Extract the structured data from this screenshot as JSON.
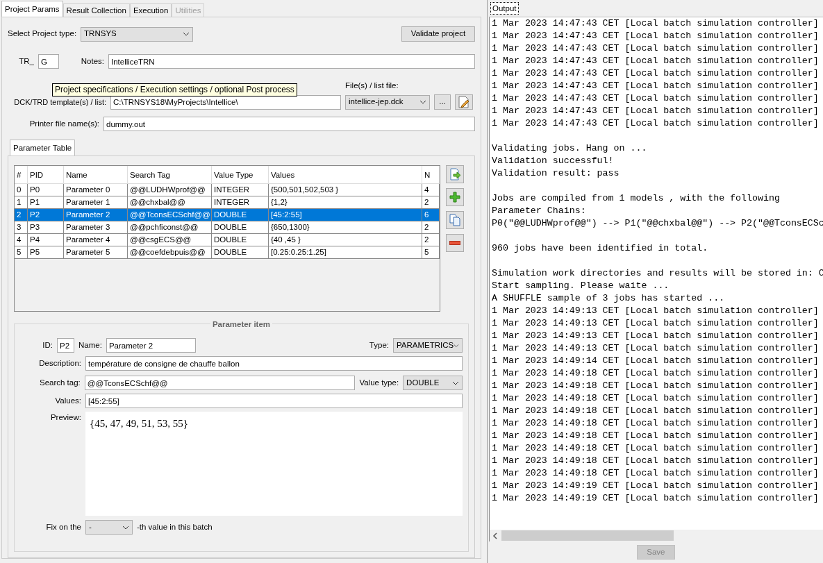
{
  "left_tabs": [
    {
      "label": "Project Params",
      "selected": true,
      "disabled": false
    },
    {
      "label": "Result Collection",
      "selected": false,
      "disabled": false
    },
    {
      "label": "Execution",
      "selected": false,
      "disabled": false
    },
    {
      "label": "Utilities",
      "selected": false,
      "disabled": true
    }
  ],
  "project_type": {
    "label": "Select Project type:",
    "value": "TRNSYS"
  },
  "validate_button": "Validate project",
  "prefix": {
    "label": "TR_",
    "value": "G"
  },
  "notes": {
    "label": "Notes:",
    "value": "IntelliceTRN"
  },
  "file_list": {
    "label": "File(s) / list file:",
    "value": "intellice-jep.dck",
    "browse_button": "..."
  },
  "template": {
    "label": "DCK/TRD template(s) / list:",
    "value": "C:\\TRNSYS18\\MyProjects\\Intellice\\"
  },
  "printer": {
    "label": "Printer file name(s):",
    "value": "dummy.out"
  },
  "tooltip": "Project specifications / Execution settings / optional Post process",
  "param_tab": {
    "label": "Parameter Table",
    "selected": true
  },
  "table": {
    "columns": [
      "#",
      "PID",
      "Name",
      "Search Tag",
      "Value Type",
      "Values",
      "N"
    ],
    "rows": [
      {
        "cells": [
          "0",
          "P0",
          "Parameter 0",
          "@@LUDHWprof@@",
          "INTEGER",
          "{500,501,502,503 }",
          "4"
        ],
        "selected": false
      },
      {
        "cells": [
          "1",
          "P1",
          "Parameter 1",
          "@@chxbal@@",
          "INTEGER",
          "{1,2}",
          "2"
        ],
        "selected": false
      },
      {
        "cells": [
          "2",
          "P2",
          "Parameter 2",
          "@@TconsECSchf@@",
          "DOUBLE",
          "[45:2:55]",
          "6"
        ],
        "selected": true
      },
      {
        "cells": [
          "3",
          "P3",
          "Parameter 3",
          "@@pchficonst@@",
          "DOUBLE",
          "{650,1300}",
          "2"
        ],
        "selected": false
      },
      {
        "cells": [
          "4",
          "P4",
          "Parameter 4",
          "@@csgECS@@",
          "DOUBLE",
          "{40 ,45 }",
          "2"
        ],
        "selected": false
      },
      {
        "cells": [
          "5",
          "P5",
          "Parameter 5",
          "@@coefdebpuis@@",
          "DOUBLE",
          "[0.25:0.25:1.25]",
          "5"
        ],
        "selected": false
      }
    ]
  },
  "param_item": {
    "title": "Parameter item",
    "id_label": "ID:",
    "id": "P2",
    "name_label": "Name:",
    "name": "Parameter 2",
    "type_label": "Type:",
    "type": "PARAMETRICS",
    "description_label": "Description:",
    "description": "température de consigne de chauffe ballon",
    "search_tag_label": "Search tag:",
    "search_tag": "@@TconsECSchf@@",
    "value_type_label": "Value type:",
    "value_type": "DOUBLE",
    "values_label": "Values:",
    "values": "[45:2:55]",
    "preview_label": "Preview:",
    "preview": "{45, 47, 49, 51, 53, 55}",
    "fix_label": "Fix on the",
    "fix_value": "-",
    "fix_suffix": "-th value in this batch"
  },
  "output": {
    "tab": "Output",
    "blocks": [
      [
        "1 Mar 2023 14:47:43 CET [Local batch simulation controller]",
        "1 Mar 2023 14:47:43 CET [Local batch simulation controller]",
        "1 Mar 2023 14:47:43 CET [Local batch simulation controller]",
        "1 Mar 2023 14:47:43 CET [Local batch simulation controller]",
        "1 Mar 2023 14:47:43 CET [Local batch simulation controller]",
        "1 Mar 2023 14:47:43 CET [Local batch simulation controller]",
        "1 Mar 2023 14:47:43 CET [Local batch simulation controller]",
        "1 Mar 2023 14:47:43 CET [Local batch simulation controller]",
        "1 Mar 2023 14:47:43 CET [Local batch simulation controller]"
      ],
      [
        "Validating jobs. Hang on ...",
        "Validation successful!",
        "Validation result: pass"
      ],
      [
        "Jobs are compiled from 1 models , with the following",
        "Parameter Chains:",
        "P0(\"@@LUDHWprof@@\") --> P1(\"@@chxbal@@\") --> P2(\"@@TconsECSc"
      ],
      [
        "960 jobs have been identified in total."
      ],
      [
        "Simulation work directories and results will be stored in: C",
        "Start sampling. Please waite ...",
        "A SHUFFLE sample of 3 jobs has started ...",
        "1 Mar 2023 14:49:13 CET [Local batch simulation controller]",
        "1 Mar 2023 14:49:13 CET [Local batch simulation controller]",
        "1 Mar 2023 14:49:13 CET [Local batch simulation controller]",
        "1 Mar 2023 14:49:13 CET [Local batch simulation controller]",
        "1 Mar 2023 14:49:14 CET [Local batch simulation controller]",
        "1 Mar 2023 14:49:18 CET [Local batch simulation controller]",
        "1 Mar 2023 14:49:18 CET [Local batch simulation controller]",
        "1 Mar 2023 14:49:18 CET [Local batch simulation controller]",
        "1 Mar 2023 14:49:18 CET [Local batch simulation controller]",
        "1 Mar 2023 14:49:18 CET [Local batch simulation controller]",
        "1 Mar 2023 14:49:18 CET [Local batch simulation controller]",
        "1 Mar 2023 14:49:18 CET [Local batch simulation controller]",
        "1 Mar 2023 14:49:18 CET [Local batch simulation controller]",
        "1 Mar 2023 14:49:18 CET [Local batch simulation controller]",
        "1 Mar 2023 14:49:19 CET [Local batch simulation controller]",
        "1 Mar 2023 14:49:19 CET [Local batch simulation controller]"
      ]
    ],
    "save_button": {
      "label": "Save",
      "disabled": true
    }
  }
}
